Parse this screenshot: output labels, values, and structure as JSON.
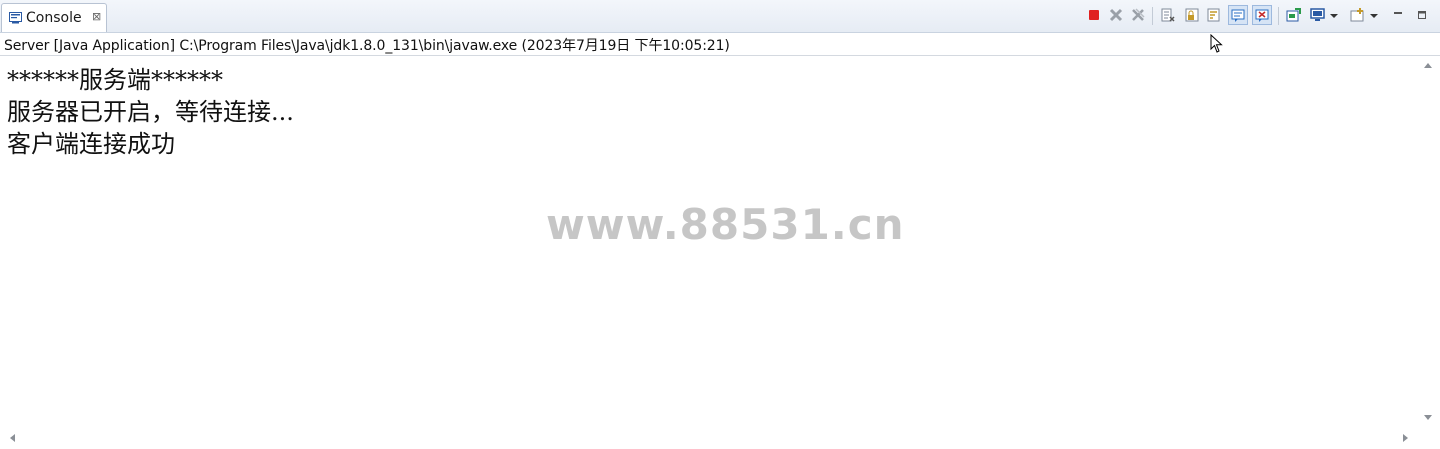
{
  "tab": {
    "icon": "console-icon",
    "label": "Console",
    "close_glyph": "⊠"
  },
  "toolbar": {
    "items": [
      {
        "name": "terminate-icon",
        "color": "#e02020"
      },
      {
        "name": "remove-launch-icon",
        "color": "#9aa0a8"
      },
      {
        "name": "remove-all-terminated-icon",
        "color": "#9aa0a8"
      },
      {
        "name": "clear-console-icon",
        "color": "#7f8a99"
      },
      {
        "name": "scroll-lock-icon",
        "color": "#c49a2a"
      },
      {
        "name": "word-wrap-icon",
        "color": "#c49a2a"
      },
      {
        "name": "show-on-stdout-icon",
        "color": "#2a6fc4"
      },
      {
        "name": "show-on-stderr-icon",
        "color": "#c42a2a"
      },
      {
        "name": "pin-console-icon",
        "color": "#2a9a4a"
      },
      {
        "name": "display-console-icon",
        "color": "#2a5aa4"
      },
      {
        "name": "open-console-icon",
        "color": "#c49a2a"
      },
      {
        "name": "minimize-icon",
        "color": "#555555"
      },
      {
        "name": "maximize-icon",
        "color": "#555555"
      }
    ]
  },
  "process": {
    "description": "Server [Java Application] C:\\Program Files\\Java\\jdk1.8.0_131\\bin\\javaw.exe (2023年7月19日 下午10:05:21)"
  },
  "console": {
    "lines": [
      "******服务端******",
      "服务器已开启，等待连接...",
      "客户端连接成功"
    ]
  },
  "watermark": "www.88531.cn"
}
